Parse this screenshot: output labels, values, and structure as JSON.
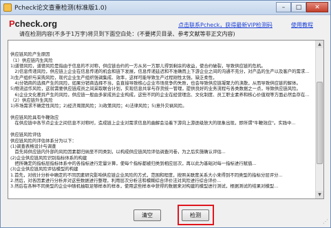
{
  "window": {
    "title": "Pcheck论文查重检测(标准版1.0)",
    "minimize": "–",
    "maximize": "□",
    "close": "✕"
  },
  "header": {
    "logo_prefix": "P",
    "logo_rest": "check.org",
    "link_contact": "点击联系Pcheck，获得最新VIP检测码",
    "link_tutorial": "使用教程"
  },
  "instruction": "请在检测内容(不多于1万字)将贝到下面空白处：(不要拷贝目录、参考文献等非正文内容)",
  "content_lines": [
    "",
    "供应链风险产生原因",
    "（1）供应链内生风险",
    "1)道德风险，道德风险是指由于信息的不对称，供应链合约的一方从另一方那儿得到剩余的收益，使合约破裂，导致供应链的危机。",
    "　2)信息传递风险，供应链上企业在信息传递的机会和链下发展，信息传递延迟和不准确而上下游企业之间的沟通不充分，对产品的生产以及客户的需求...",
    "3)生产组织与采购风险，现代企业生产组织强调集成、效率，这样可能导致生产过程刚性太强，缺乏柔性，",
    "　4)分销商的选择产生的风险，如果分销商选择不当，会直接导致核心企业市场竞争的失败，也会导致供应链凝聚力的涣散，从而导致供应链的解体。",
    "5)物流运作风险，这就需要供应链成员之间采取联合计划，实现信息共享与存货统一管理，提供良好的业务流程与各类数据之一点，导致供应链风险。",
    "　6)企业文化差异产生的风险，供应链一般由多家成员企业构成，这些不同的企业在经营理念、文化制度、员工职业素养和核心价值观等方面必然会存在...",
    "（2）供应链外生风险",
    "1)市场需求不确定性风险；2)经济周期风险；3)政策风险；4)法律风险；5)意外灾祸风险。",
    "",
    "供应链风险具有牛鞭效应",
    "　在供应链中各节点企业之间信息不对称时，造成链上企业对需求信息的曲解会沿着下游向上游逐级放大的现象出现，即所谓\"牛鞭效应\"。实践中...",
    "",
    "供应链风险评估",
    "供应链风险的评估体系分为以下：",
    "(1)调查表格设计与调查",
    "　首先将供应链内外部的风险因素都归纳至不同类别，以构成供应链风险评估调查问卷，为之后实施确认评估...",
    "(2)企业供应链风险识别指标体系的构建",
    "　把所确定的指标层指标体系中的各指标进行定量计算，使每个指标都被归类到相应层次，再以此为基础对每一指标进行赋值...",
    "(3)企业供应链风险评估模型的构建",
    "1.首先，对统计分析中确定的不同因素研究影响供应链企业风险的方式，范围和程度，按照关联度关系大小来得到不同类型的指标分层评分...",
    "2.然后，对各因素进行分析并对这些数据进行整理，利用层次分析法和模糊综合评价法对风险进行综合评价...",
    "3.然后在各种不同类型的企业中随机抽取足够样本的样本，使用这些样本中获得的数据来对构建的模型进行测试，根据测试的结果对模型..."
  ],
  "buttons": {
    "clear": "清空",
    "check": "检测"
  },
  "colors": {
    "logo_accent": "#d0181f",
    "link": "#1a3fd8",
    "highlight_box": "#e0141c"
  },
  "icons": {
    "scroll_up": "▲",
    "scroll_down": "▼",
    "size_grip": "⋰"
  }
}
